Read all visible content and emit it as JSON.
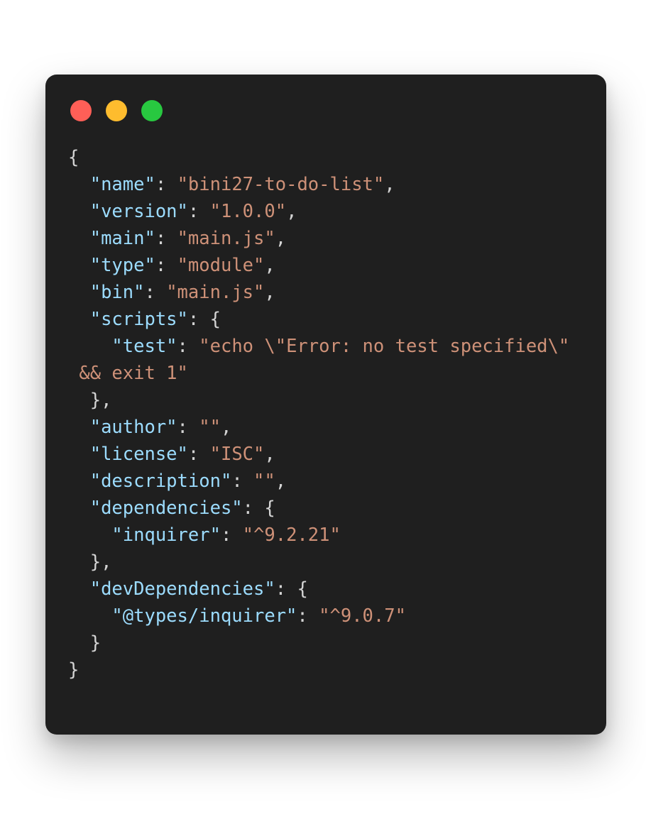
{
  "window": {
    "controls": [
      "close",
      "minimize",
      "maximize"
    ],
    "colors": {
      "close": "#ff5f57",
      "minimize": "#febc2e",
      "maximize": "#28c840",
      "background": "#1f1f1f",
      "key": "#9cdcfe",
      "string": "#ce9178",
      "punctuation": "#d4d4d4"
    }
  },
  "code": {
    "lines": [
      {
        "indent": "",
        "key": "",
        "sep": "",
        "value": "",
        "tail": "{"
      },
      {
        "indent": "  ",
        "key": "\"name\"",
        "sep": ": ",
        "value": "\"bini27-to-do-list\"",
        "tail": ","
      },
      {
        "indent": "  ",
        "key": "\"version\"",
        "sep": ": ",
        "value": "\"1.0.0\"",
        "tail": ","
      },
      {
        "indent": "  ",
        "key": "\"main\"",
        "sep": ": ",
        "value": "\"main.js\"",
        "tail": ","
      },
      {
        "indent": "  ",
        "key": "\"type\"",
        "sep": ": ",
        "value": "\"module\"",
        "tail": ","
      },
      {
        "indent": "  ",
        "key": "\"bin\"",
        "sep": ": ",
        "value": "\"main.js\"",
        "tail": ","
      },
      {
        "indent": "  ",
        "key": "\"scripts\"",
        "sep": ": ",
        "value": "",
        "tail": "{"
      },
      {
        "indent": "    ",
        "key": "\"test\"",
        "sep": ": ",
        "value": "\"echo \\\"Error: no test specified\\\"",
        "tail": ""
      },
      {
        "indent": " ",
        "key": "",
        "sep": "",
        "value": "&& exit 1\"",
        "tail": ""
      },
      {
        "indent": "  ",
        "key": "",
        "sep": "",
        "value": "",
        "tail": "},"
      },
      {
        "indent": "  ",
        "key": "\"author\"",
        "sep": ": ",
        "value": "\"\"",
        "tail": ","
      },
      {
        "indent": "  ",
        "key": "\"license\"",
        "sep": ": ",
        "value": "\"ISC\"",
        "tail": ","
      },
      {
        "indent": "  ",
        "key": "\"description\"",
        "sep": ": ",
        "value": "\"\"",
        "tail": ","
      },
      {
        "indent": "  ",
        "key": "\"dependencies\"",
        "sep": ": ",
        "value": "",
        "tail": "{"
      },
      {
        "indent": "    ",
        "key": "\"inquirer\"",
        "sep": ": ",
        "value": "\"^9.2.21\"",
        "tail": ""
      },
      {
        "indent": "  ",
        "key": "",
        "sep": "",
        "value": "",
        "tail": "},"
      },
      {
        "indent": "  ",
        "key": "\"devDependencies\"",
        "sep": ": ",
        "value": "",
        "tail": "{"
      },
      {
        "indent": "    ",
        "key": "\"@types/inquirer\"",
        "sep": ": ",
        "value": "\"^9.0.7\"",
        "tail": ""
      },
      {
        "indent": "  ",
        "key": "",
        "sep": "",
        "value": "",
        "tail": "}"
      },
      {
        "indent": "",
        "key": "",
        "sep": "",
        "value": "",
        "tail": "}"
      }
    ]
  }
}
